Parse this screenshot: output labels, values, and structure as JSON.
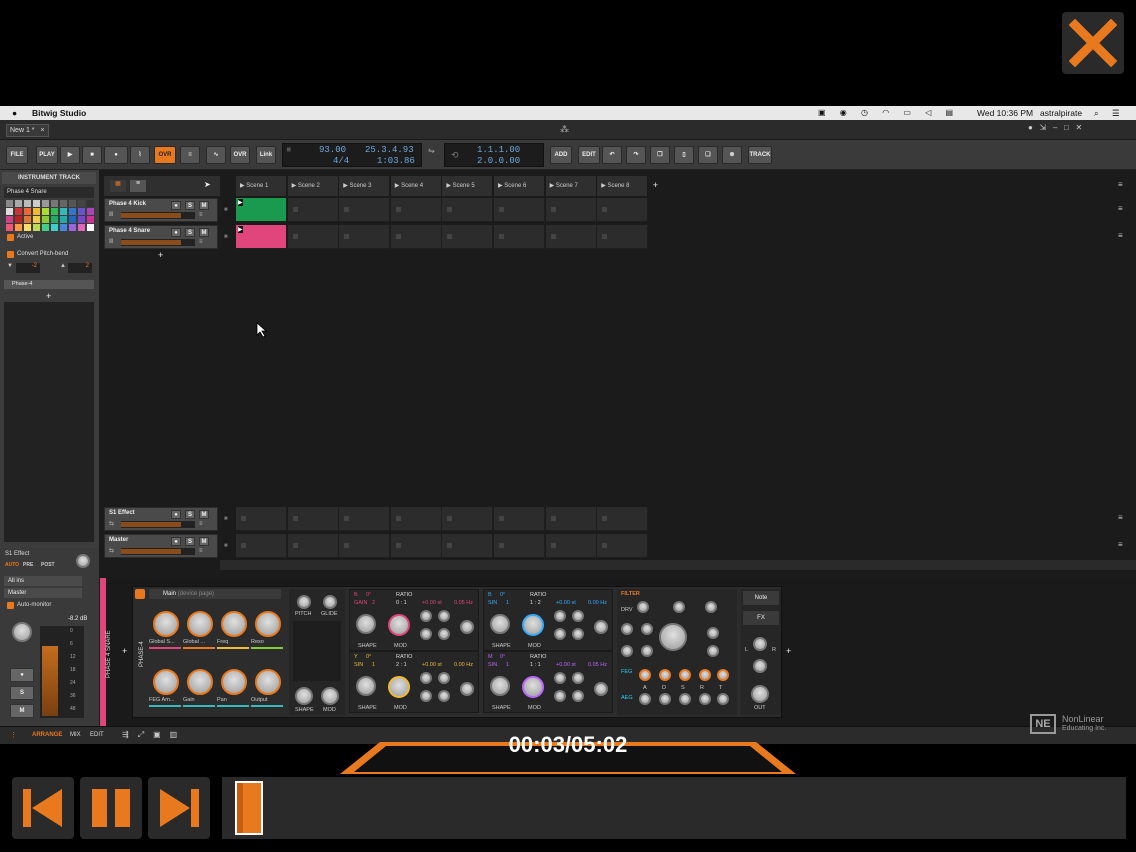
{
  "overlay": {
    "close_icon": "close-x-icon",
    "accent": "#e8791e"
  },
  "macbar": {
    "apple_icon": "apple-icon",
    "app_name": "Bitwig Studio",
    "clock": "Wed 10:36 PM",
    "user": "astralpirate"
  },
  "app_tab": {
    "label": "New 1 *",
    "close": "×"
  },
  "toolbar": {
    "file": "FILE",
    "play_label": "PLAY",
    "ovr": "OVR",
    "ovr2": "OVR",
    "link": "Link",
    "tempo": "93.00",
    "time_sig": "4/4",
    "position": "25.3.4.93",
    "time": "1:03.86",
    "loop_start": "1.1.1.00",
    "loop_len": "2.0.0.00",
    "add": "ADD",
    "edit": "EDIT",
    "track": "TRACK"
  },
  "inspector": {
    "header": "INSTRUMENT TRACK",
    "track_name": "Phase 4 Snare",
    "active": "Active",
    "convert": "Convert Pitch-bend",
    "pitch_down": "-2",
    "pitch_up": "2",
    "device": "Phase-4",
    "plus": "+"
  },
  "tracks": [
    {
      "name": "Phase 4 Kick",
      "s": "S",
      "m": "M",
      "clip_color": "#1a9a4e"
    },
    {
      "name": "Phase 4 Snare",
      "s": "S",
      "m": "M",
      "clip_color": "#e0457b"
    }
  ],
  "effect_tracks": [
    {
      "name": "S1 Effect",
      "s": "S",
      "m": "M"
    },
    {
      "name": "Master",
      "s": "S",
      "m": "M"
    }
  ],
  "scenes": [
    "Scene 1",
    "Scene 2",
    "Scene 3",
    "Scene 4",
    "Scene 5",
    "Scene 6",
    "Scene 7",
    "Scene 8"
  ],
  "mixer": {
    "send_label": "S1 Effect",
    "tabs": [
      "AUTO",
      "PRE",
      "POST"
    ],
    "input": "All ins",
    "output": "Master",
    "monitor": "Auto-monitor",
    "db": "-8.2 dB",
    "s": "S",
    "m": "M",
    "meter_scale": [
      "0",
      "6",
      "12",
      "18",
      "24",
      "36",
      "48"
    ]
  },
  "device": {
    "track_vertical": "PHASE 4 SNARE",
    "device_vertical": "PHASE-4",
    "page": "Main",
    "page_hint": "(device page)",
    "macros": [
      "Global S...",
      "Global ...",
      "Freq",
      "Reso",
      "FEG Am...",
      "Gain",
      "Pan",
      "Output"
    ],
    "pitch": "PITCH",
    "glide": "GLIDE",
    "shape": "SHAPE",
    "mod": "MOD",
    "osc_a": {
      "label_b": "B",
      "deg": "0°",
      "gain": "GAIN",
      "gain_val": "2",
      "ratio": "RATIO",
      "ratio_val": "0 : 1",
      "st": "+0.00 st",
      "hz": "0.05 Hz"
    },
    "osc_b": {
      "label_b": "B",
      "deg": "0°",
      "sin": "SIN",
      "sin_val": "1",
      "ratio": "RATIO",
      "ratio_val": "1 : 2",
      "st": "+0.00 st",
      "hz": "0.00 Hz"
    },
    "osc_y": {
      "label": "Y",
      "deg": "0°",
      "sin": "SIN",
      "sin_val": "1",
      "ratio": "RATIO",
      "ratio_val": "2 : 1",
      "st": "+0.00 st",
      "hz": "0.00 Hz"
    },
    "osc_m": {
      "label": "M",
      "deg": "0°",
      "sin": "SIN",
      "sin_val": "1",
      "ratio": "RATIO",
      "ratio_val": "1 : 1",
      "st": "+0.00 st",
      "hz": "0.05 Hz"
    },
    "filter": "FILTER",
    "drv": "DRV",
    "feg": "FEG",
    "aeg": "AEG",
    "adsr": [
      "A",
      "D",
      "S",
      "R",
      "T"
    ],
    "note": "Note",
    "fx": "FX",
    "out": "OUT",
    "lr": [
      "L",
      "R"
    ]
  },
  "bottom_bar": {
    "arrange": "ARRANGE",
    "mix": "MIX",
    "edit": "EDIT"
  },
  "player": {
    "timecode": "00:03/05:02",
    "progress": 0.01,
    "prev_icon": "skip-back-icon",
    "pause_icon": "pause-icon",
    "next_icon": "skip-forward-icon"
  },
  "watermark": {
    "line1": "NonLinear",
    "line2": "Educating Inc.",
    "logo": "NE"
  }
}
